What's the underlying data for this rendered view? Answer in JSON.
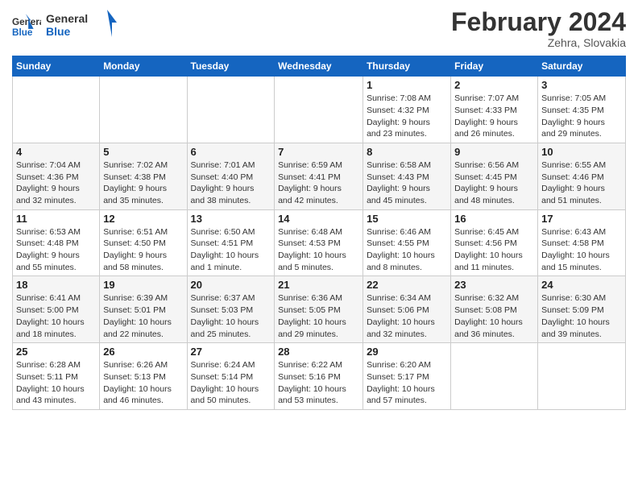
{
  "logo": {
    "general": "General",
    "blue": "Blue"
  },
  "header": {
    "month_year": "February 2024",
    "location": "Zehra, Slovakia"
  },
  "days_of_week": [
    "Sunday",
    "Monday",
    "Tuesday",
    "Wednesday",
    "Thursday",
    "Friday",
    "Saturday"
  ],
  "weeks": [
    [
      {
        "day": "",
        "info": ""
      },
      {
        "day": "",
        "info": ""
      },
      {
        "day": "",
        "info": ""
      },
      {
        "day": "",
        "info": ""
      },
      {
        "day": "1",
        "info": "Sunrise: 7:08 AM\nSunset: 4:32 PM\nDaylight: 9 hours\nand 23 minutes."
      },
      {
        "day": "2",
        "info": "Sunrise: 7:07 AM\nSunset: 4:33 PM\nDaylight: 9 hours\nand 26 minutes."
      },
      {
        "day": "3",
        "info": "Sunrise: 7:05 AM\nSunset: 4:35 PM\nDaylight: 9 hours\nand 29 minutes."
      }
    ],
    [
      {
        "day": "4",
        "info": "Sunrise: 7:04 AM\nSunset: 4:36 PM\nDaylight: 9 hours\nand 32 minutes."
      },
      {
        "day": "5",
        "info": "Sunrise: 7:02 AM\nSunset: 4:38 PM\nDaylight: 9 hours\nand 35 minutes."
      },
      {
        "day": "6",
        "info": "Sunrise: 7:01 AM\nSunset: 4:40 PM\nDaylight: 9 hours\nand 38 minutes."
      },
      {
        "day": "7",
        "info": "Sunrise: 6:59 AM\nSunset: 4:41 PM\nDaylight: 9 hours\nand 42 minutes."
      },
      {
        "day": "8",
        "info": "Sunrise: 6:58 AM\nSunset: 4:43 PM\nDaylight: 9 hours\nand 45 minutes."
      },
      {
        "day": "9",
        "info": "Sunrise: 6:56 AM\nSunset: 4:45 PM\nDaylight: 9 hours\nand 48 minutes."
      },
      {
        "day": "10",
        "info": "Sunrise: 6:55 AM\nSunset: 4:46 PM\nDaylight: 9 hours\nand 51 minutes."
      }
    ],
    [
      {
        "day": "11",
        "info": "Sunrise: 6:53 AM\nSunset: 4:48 PM\nDaylight: 9 hours\nand 55 minutes."
      },
      {
        "day": "12",
        "info": "Sunrise: 6:51 AM\nSunset: 4:50 PM\nDaylight: 9 hours\nand 58 minutes."
      },
      {
        "day": "13",
        "info": "Sunrise: 6:50 AM\nSunset: 4:51 PM\nDaylight: 10 hours\nand 1 minute."
      },
      {
        "day": "14",
        "info": "Sunrise: 6:48 AM\nSunset: 4:53 PM\nDaylight: 10 hours\nand 5 minutes."
      },
      {
        "day": "15",
        "info": "Sunrise: 6:46 AM\nSunset: 4:55 PM\nDaylight: 10 hours\nand 8 minutes."
      },
      {
        "day": "16",
        "info": "Sunrise: 6:45 AM\nSunset: 4:56 PM\nDaylight: 10 hours\nand 11 minutes."
      },
      {
        "day": "17",
        "info": "Sunrise: 6:43 AM\nSunset: 4:58 PM\nDaylight: 10 hours\nand 15 minutes."
      }
    ],
    [
      {
        "day": "18",
        "info": "Sunrise: 6:41 AM\nSunset: 5:00 PM\nDaylight: 10 hours\nand 18 minutes."
      },
      {
        "day": "19",
        "info": "Sunrise: 6:39 AM\nSunset: 5:01 PM\nDaylight: 10 hours\nand 22 minutes."
      },
      {
        "day": "20",
        "info": "Sunrise: 6:37 AM\nSunset: 5:03 PM\nDaylight: 10 hours\nand 25 minutes."
      },
      {
        "day": "21",
        "info": "Sunrise: 6:36 AM\nSunset: 5:05 PM\nDaylight: 10 hours\nand 29 minutes."
      },
      {
        "day": "22",
        "info": "Sunrise: 6:34 AM\nSunset: 5:06 PM\nDaylight: 10 hours\nand 32 minutes."
      },
      {
        "day": "23",
        "info": "Sunrise: 6:32 AM\nSunset: 5:08 PM\nDaylight: 10 hours\nand 36 minutes."
      },
      {
        "day": "24",
        "info": "Sunrise: 6:30 AM\nSunset: 5:09 PM\nDaylight: 10 hours\nand 39 minutes."
      }
    ],
    [
      {
        "day": "25",
        "info": "Sunrise: 6:28 AM\nSunset: 5:11 PM\nDaylight: 10 hours\nand 43 minutes."
      },
      {
        "day": "26",
        "info": "Sunrise: 6:26 AM\nSunset: 5:13 PM\nDaylight: 10 hours\nand 46 minutes."
      },
      {
        "day": "27",
        "info": "Sunrise: 6:24 AM\nSunset: 5:14 PM\nDaylight: 10 hours\nand 50 minutes."
      },
      {
        "day": "28",
        "info": "Sunrise: 6:22 AM\nSunset: 5:16 PM\nDaylight: 10 hours\nand 53 minutes."
      },
      {
        "day": "29",
        "info": "Sunrise: 6:20 AM\nSunset: 5:17 PM\nDaylight: 10 hours\nand 57 minutes."
      },
      {
        "day": "",
        "info": ""
      },
      {
        "day": "",
        "info": ""
      }
    ]
  ]
}
